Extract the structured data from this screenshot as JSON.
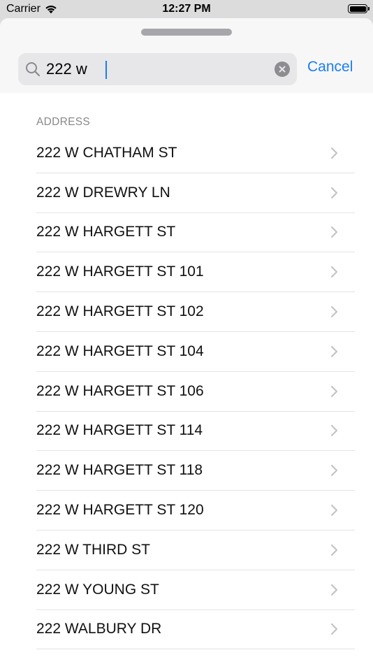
{
  "status_bar": {
    "carrier": "Carrier",
    "time": "12:27 PM"
  },
  "search": {
    "query": "222 w",
    "cancel_label": "Cancel"
  },
  "results": {
    "section_title": "ADDRESS",
    "items": [
      {
        "label": "222 W CHATHAM ST"
      },
      {
        "label": "222 W DREWRY LN"
      },
      {
        "label": "222 W HARGETT ST"
      },
      {
        "label": "222 W HARGETT ST 101"
      },
      {
        "label": "222 W HARGETT ST 102"
      },
      {
        "label": "222 W HARGETT ST 104"
      },
      {
        "label": "222 W HARGETT ST 106"
      },
      {
        "label": "222 W HARGETT ST 114"
      },
      {
        "label": "222 W HARGETT ST 118"
      },
      {
        "label": "222 W HARGETT ST 120"
      },
      {
        "label": "222 W THIRD ST"
      },
      {
        "label": "222 W YOUNG ST"
      },
      {
        "label": "222 WALBURY DR"
      }
    ]
  },
  "icons": {
    "search": "magnifying-glass-icon",
    "clear": "clear-circle-icon",
    "row_disclosure": "chevron-right-icon",
    "wifi": "wifi-icon",
    "battery": "battery-icon"
  },
  "colors": {
    "accent": "#1a7cf5",
    "chevron": "#c4c4c7",
    "section_header": "#888888"
  }
}
